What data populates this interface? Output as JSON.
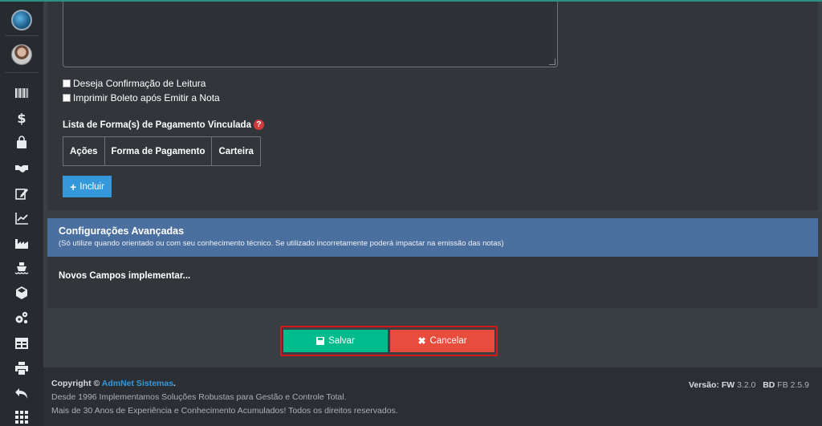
{
  "form": {
    "checkbox_confirmacao": "Deseja Confirmação de Leitura",
    "checkbox_boleto": "Imprimir Boleto após Emitir a Nota",
    "list_label": "Lista de Forma(s) de Pagamento Vinculada",
    "table_headers": [
      "Ações",
      "Forma de Pagamento",
      "Carteira"
    ],
    "incluir_label": "Incluir"
  },
  "advanced": {
    "title": "Configurações Avançadas",
    "subtitle": "(Só utilize quando orientado ou com seu conhecimento técnico. Se utilizado incorretamente poderá impactar na emissão das notas)",
    "body_text": "Novos Campos implementar..."
  },
  "actions": {
    "save_label": "Salvar",
    "cancel_label": "Cancelar"
  },
  "footer": {
    "copyright_prefix": "Copyright ©",
    "brand": "AdmNet Sistemas",
    "copyright_suffix": ".",
    "line1": "Desde 1996 Implementamos Soluções Robustas para Gestão e Controle Total.",
    "line2": "Mais de 30 Anos de Experiência e Conhecimento Acumulados! Todos os direitos reservados.",
    "version_label": "Versão:",
    "fw_label": "FW",
    "fw_version": "3.2.0",
    "bd_label": "BD",
    "bd_version": "FB 2.5.9"
  },
  "sidebar": {
    "icons": [
      "barcode-icon",
      "dollar-icon",
      "shopping-bag-icon",
      "handshake-icon",
      "edit-icon",
      "line-chart-icon",
      "industry-icon",
      "ship-icon",
      "cube-icon",
      "cogs-icon",
      "table-icon",
      "print-icon",
      "undo-icon",
      "grid-icon"
    ]
  },
  "colors": {
    "accent_success": "#00bc8c",
    "accent_danger": "#e74c3c",
    "accent_primary": "#3498db",
    "panel_header": "#4b6f9f"
  }
}
